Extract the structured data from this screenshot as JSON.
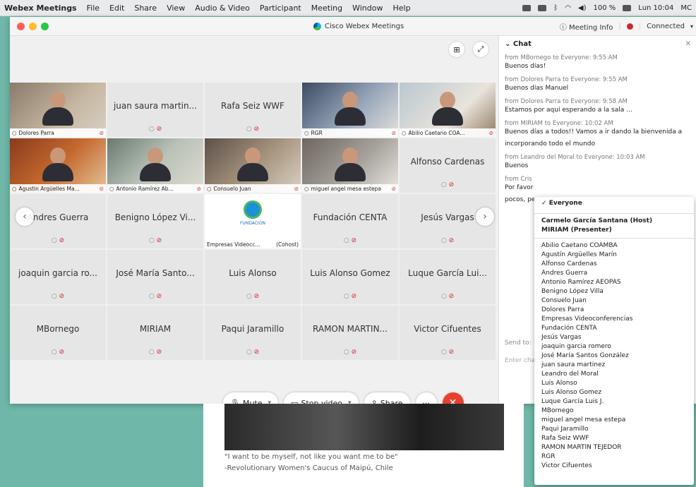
{
  "menubar": {
    "app": "Webex Meetings",
    "items": [
      "File",
      "Edit",
      "Share",
      "View",
      "Audio & Video",
      "Participant",
      "Meeting",
      "Window",
      "Help"
    ],
    "battery": "100 %",
    "clock": "Lun 10:04",
    "user": "MC"
  },
  "window": {
    "title": "Cisco Webex Meetings",
    "meeting_info": "Meeting Info",
    "status": "Connected"
  },
  "colors": {
    "accent_end": "#e6412e",
    "muted": "#d0242b",
    "webex_green": "#54b948"
  },
  "grid": {
    "tiles": [
      {
        "name": "Dolores Parra",
        "video": true,
        "cls": "v1"
      },
      {
        "name": "juan saura martin...",
        "video": false
      },
      {
        "name": "Rafa Seiz WWF",
        "video": false
      },
      {
        "name": "RGR",
        "video": true,
        "cls": "v2"
      },
      {
        "name": "Abilio Caetano COA...",
        "video": true,
        "cls": "v3"
      },
      {
        "name": "Agustin Argüelles Ma...",
        "video": true,
        "cls": "v4"
      },
      {
        "name": "Antonio Ramírez Ab...",
        "video": true,
        "cls": "v5"
      },
      {
        "name": "Consuelo Juan",
        "video": true,
        "cls": "v6"
      },
      {
        "name": "miguel angel mesa estepa",
        "video": true,
        "cls": "v7"
      },
      {
        "name": "Alfonso Cardenas",
        "video": false
      },
      {
        "name": "Andres Guerra",
        "video": false
      },
      {
        "name": "Benigno López Vi...",
        "video": false
      },
      {
        "name": "Empresas Videocc...",
        "video": false,
        "logo": true,
        "extra": "(Cohost)",
        "logo_caption": "FUNDACIÓN"
      },
      {
        "name": "Fundación CENTA",
        "video": false
      },
      {
        "name": "Jesús Vargas",
        "video": false
      },
      {
        "name": "joaquin garcia ro...",
        "video": false
      },
      {
        "name": "José María Santo...",
        "video": false
      },
      {
        "name": "Luis Alonso",
        "video": false
      },
      {
        "name": "Luis Alonso Gomez",
        "video": false
      },
      {
        "name": "Luque García Lui...",
        "video": false
      },
      {
        "name": "MBornego",
        "video": false
      },
      {
        "name": "MIRIAM",
        "video": false
      },
      {
        "name": "Paqui Jaramillo",
        "video": false
      },
      {
        "name": "RAMON MARTIN...",
        "video": false
      },
      {
        "name": "Victor Cifuentes",
        "video": false
      }
    ]
  },
  "controls": {
    "mute": "Mute",
    "stop_video": "Stop video",
    "share": "Share",
    "more": "···",
    "end": "✕"
  },
  "chat": {
    "title": "Chat",
    "messages": [
      {
        "from": "from MBornego to Everyone:   9:55 AM",
        "text": "Buenos días!"
      },
      {
        "from": "from Dolores Parra to Everyone:   9:55 AM",
        "text": "Buenos días Manuel"
      },
      {
        "from": "from Dolores Parra to Everyone:   9:58 AM",
        "text": "Estamos por aquí esperando a la sala ..."
      },
      {
        "from": "from MIRIAM to Everyone:   10:02 AM",
        "text": "Buenos días a todos!! Vamos a ir dando la bienvenida a"
      },
      {
        "from": "",
        "text": "incorporando todo el mundo"
      },
      {
        "from": "from Leandro del Moral to Everyone:   10:03 AM",
        "text": "Buenos"
      },
      {
        "from": "from Cris",
        "text": "Por favor"
      },
      {
        "from": "",
        "text": "pocos, pe"
      }
    ],
    "send_to": "Send to:",
    "enter": "Enter chat message here"
  },
  "dropdown": {
    "everyone": "Everyone",
    "hosts": [
      "Carmelo García Santana (Host)",
      "MIRIAM (Presenter)"
    ],
    "people": [
      "Abilio Caetano COAMBA",
      "Agustín Argüelles Marín",
      "Alfonso Cardenas",
      "Andres Guerra",
      "Antonio Ramírez AEOPAS",
      "Benigno López Villa",
      "Consuelo Juan",
      "Dolores Parra",
      "Empresas Videoconferencias",
      "Fundación CENTA",
      "Jesús Vargas",
      "joaquin garcia romero",
      "José María Santos González",
      "juan saura martinez",
      "Leandro del Moral",
      "Luis Alonso",
      "Luis Alonso Gomez",
      "Luque García Luis J.",
      "MBornego",
      "miguel angel mesa estepa",
      "Paqui Jaramillo",
      "Rafa Seiz WWF",
      "RAMON MARTIN TEJEDOR",
      "RGR",
      "Victor Cifuentes"
    ]
  },
  "doc": {
    "quote": "\"I want to be myself, not like you want me to be\"",
    "attrib": "-Revolutionary Women's Caucus of Maipú, Chile"
  }
}
